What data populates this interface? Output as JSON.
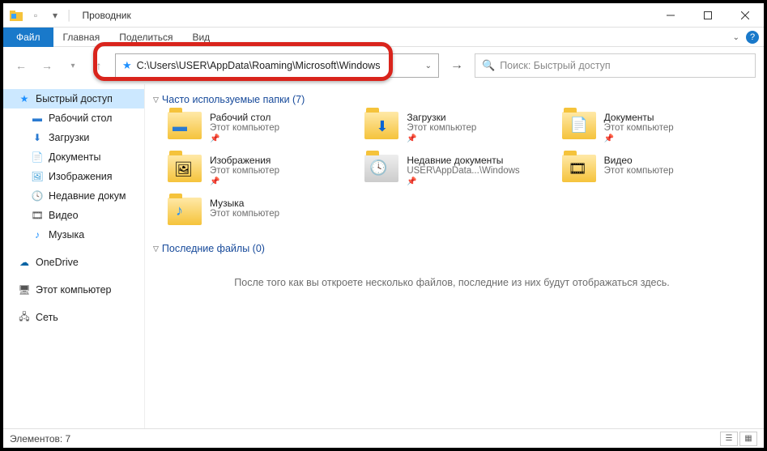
{
  "titlebar": {
    "title": "Проводник"
  },
  "ribbon": {
    "file": "Файл",
    "tabs": [
      "Главная",
      "Поделиться",
      "Вид"
    ]
  },
  "nav": {
    "address": "C:\\Users\\USER\\AppData\\Roaming\\Microsoft\\Windows",
    "search_placeholder": "Поиск: Быстрый доступ"
  },
  "navpane": {
    "quick_access": "Быстрый доступ",
    "items": [
      {
        "label": "Рабочий стол"
      },
      {
        "label": "Загрузки"
      },
      {
        "label": "Документы"
      },
      {
        "label": "Изображения"
      },
      {
        "label": "Недавние докум"
      },
      {
        "label": "Видео"
      },
      {
        "label": "Музыка"
      }
    ],
    "onedrive": "OneDrive",
    "this_pc": "Этот компьютер",
    "network": "Сеть"
  },
  "content": {
    "section_frequent": "Часто используемые папки (7)",
    "section_recent": "Последние файлы (0)",
    "empty_recent": "После того как вы откроете несколько файлов, последние из них будут отображаться здесь.",
    "this_computer": "Этот компьютер",
    "folders": [
      {
        "label": "Рабочий стол",
        "sub": "Этот компьютер",
        "pin": true
      },
      {
        "label": "Загрузки",
        "sub": "Этот компьютер",
        "pin": true
      },
      {
        "label": "Документы",
        "sub": "Этот компьютер",
        "pin": true
      },
      {
        "label": "Изображения",
        "sub": "Этот компьютер",
        "pin": true
      },
      {
        "label": "Недавние документы",
        "sub": "USER\\AppData...\\Windows",
        "pin": true
      },
      {
        "label": "Видео",
        "sub": "Этот компьютер",
        "pin": false
      },
      {
        "label": "Музыка",
        "sub": "Этот компьютер",
        "pin": false
      }
    ]
  },
  "statusbar": {
    "elements": "Элементов: 7"
  }
}
